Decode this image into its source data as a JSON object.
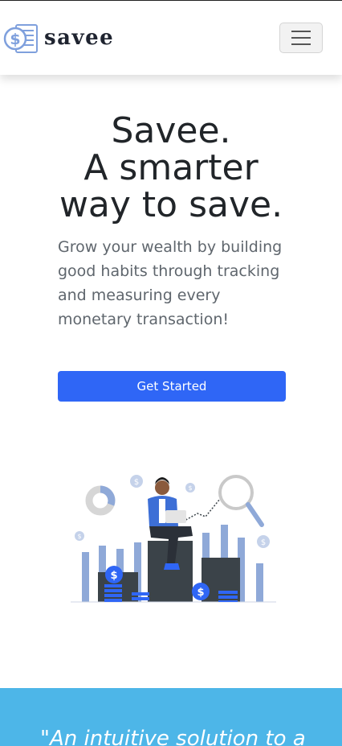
{
  "nav": {
    "brand_name": "savee",
    "logo_icon": "dollar-coin-logo-icon",
    "menu_icon": "hamburger-menu-icon"
  },
  "hero": {
    "title_lines": [
      "Savee.",
      "A smarter",
      "way to save."
    ],
    "description": "Grow your wealth by building good habits through tracking and measuring every monetary transaction!",
    "cta_label": "Get Started",
    "illustration": "person-sitting-on-bar-chart-with-coins-illustration"
  },
  "testimonial": {
    "quote": "\"An intuitive solution to a"
  },
  "colors": {
    "primary": "#2f66f6",
    "band": "#4db6e8",
    "illustration_blue": "#8fa9d8",
    "illustration_dark": "#3b4349"
  }
}
